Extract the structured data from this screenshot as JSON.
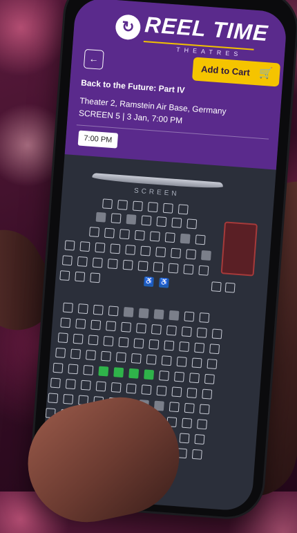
{
  "brand": {
    "name": "REEL TIME",
    "sub": "THEATRES",
    "mark": "↻"
  },
  "header": {
    "back_icon": "back-arrow-icon",
    "cart_label": "Add to Cart",
    "cart_icon": "cart-icon"
  },
  "movie": {
    "title": "Back to the Future: Part IV",
    "venue": "Theater 2, Ramstein Air Base, Germany",
    "screen_info": "SCREEN 5 | 3 Jan, 7:00 PM"
  },
  "showtime": {
    "selected": "7:00 PM"
  },
  "seatmap": {
    "screen_label": "SCREEN",
    "colors": {
      "available": "#c9ccd6",
      "taken": "#7b7f8a",
      "selected": "#2fb34a",
      "accessible": "#1f5fb5"
    }
  }
}
